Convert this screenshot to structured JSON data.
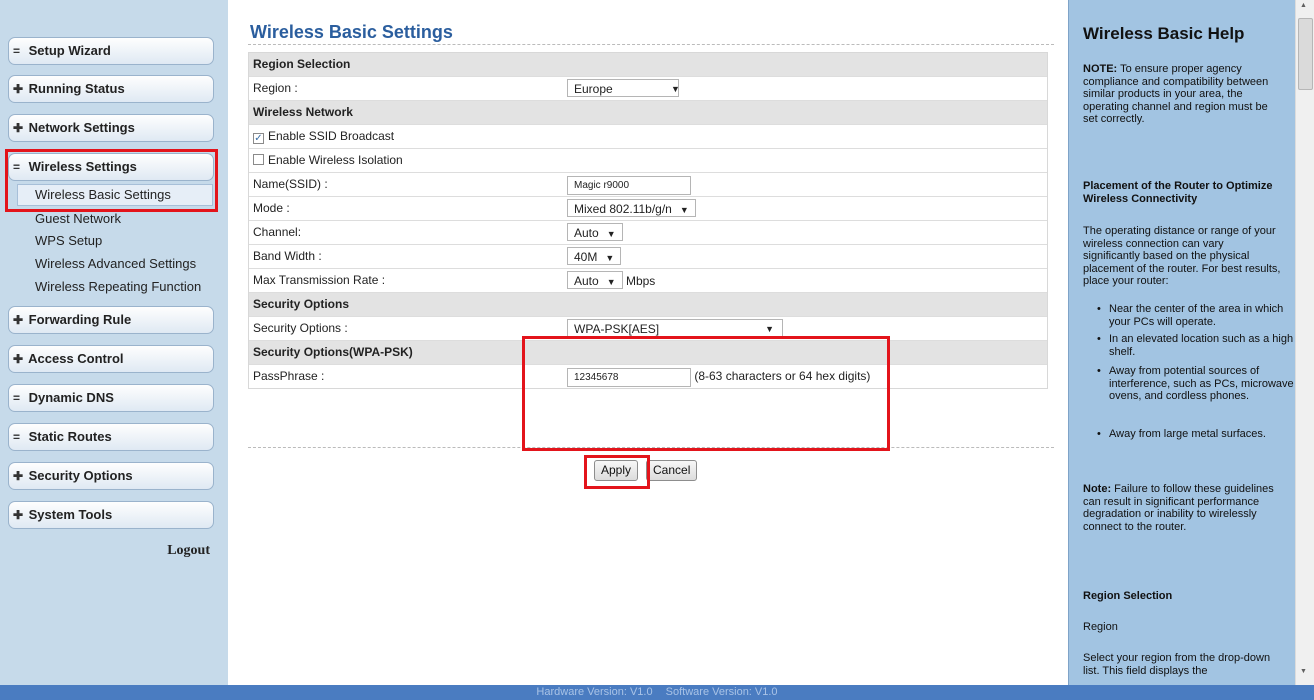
{
  "sidebar": {
    "menu": [
      {
        "label": "Setup Wizard",
        "icon": "collapse-icon",
        "icon_glyph": "="
      },
      {
        "label": "Running Status",
        "icon": "expand-icon",
        "icon_glyph": "✚"
      },
      {
        "label": "Network Settings",
        "icon": "expand-icon",
        "icon_glyph": "✚"
      },
      {
        "label": "Wireless Settings",
        "icon": "collapse-icon",
        "icon_glyph": "="
      },
      {
        "label": "Forwarding Rule",
        "icon": "expand-icon",
        "icon_glyph": "✚"
      },
      {
        "label": "Access Control",
        "icon": "expand-icon",
        "icon_glyph": "✚"
      },
      {
        "label": "Dynamic DNS",
        "icon": "collapse-icon",
        "icon_glyph": "="
      },
      {
        "label": "Static Routes",
        "icon": "collapse-icon",
        "icon_glyph": "="
      },
      {
        "label": "Security Options",
        "icon": "expand-icon",
        "icon_glyph": "✚"
      },
      {
        "label": "System Tools",
        "icon": "expand-icon",
        "icon_glyph": "✚"
      }
    ],
    "submenu": [
      "Wireless Basic Settings",
      "Guest Network",
      "WPS Setup",
      "Wireless Advanced Settings",
      "Wireless Repeating Function"
    ],
    "logout": "Logout"
  },
  "main": {
    "title": "Wireless Basic Settings",
    "region_section": "Region Selection",
    "region_label": "Region :",
    "region_value": "Europe",
    "wireless_section": "Wireless Network",
    "ssid_broadcast_label": "Enable SSID Broadcast",
    "ssid_broadcast_checked": true,
    "isolation_label": "Enable Wireless Isolation",
    "isolation_checked": false,
    "ssid_label": "Name(SSID) :",
    "ssid_value": "Magic r9000",
    "mode_label": "Mode :",
    "mode_value": "Mixed 802.11b/g/n",
    "channel_label": "Channel:",
    "channel_value": "Auto",
    "bandwidth_label": "Band Width :",
    "bandwidth_value": "40M",
    "rate_label": "Max Transmission Rate :",
    "rate_value": "Auto",
    "rate_unit": "Mbps",
    "security_section": "Security Options",
    "security_label": "Security Options :",
    "security_value": "WPA-PSK[AES]",
    "wpa_section": "Security Options(WPA-PSK)",
    "passphrase_label": "PassPhrase :",
    "passphrase_value": "12345678",
    "passphrase_hint": "(8-63 characters or 64 hex digits)",
    "apply_label": "Apply",
    "cancel_label": "Cancel"
  },
  "help": {
    "title": "Wireless Basic Help",
    "note_bold": "NOTE:",
    "note_text": " To ensure proper agency compliance and compatibility between similar products in your area, the operating channel and region must be set correctly.",
    "placement_title": "Placement of the Router to Optimize Wireless Connectivity",
    "placement_text": "The operating distance or range of your wireless connection can vary significantly based on the physical placement of the router. For best results, place your router:",
    "bullets": [
      "Near the center of the area in which your PCs will operate.",
      "In an elevated location such as a high shelf.",
      "Away from potential sources of interference, such as PCs, microwave ovens, and cordless phones.",
      "Away from large metal surfaces."
    ],
    "note2_bold": "Note:",
    "note2_text": " Failure to follow these guidelines can result in significant performance degradation or inability to wirelessly connect to the router.",
    "region_title": "Region Selection",
    "region_sub": "Region",
    "region_text": "Select your region from the drop-down list. This field displays the"
  },
  "footer": {
    "hardware": "Hardware Version: V1.0",
    "software": "Software Version: V1.0"
  },
  "colors": {
    "sidebar_bg": "#c6daea",
    "help_bg": "#a2c4e2",
    "title_blue": "#2b5e9e",
    "highlight_red": "#e3141b",
    "footer_blue": "#4a7cc1"
  }
}
